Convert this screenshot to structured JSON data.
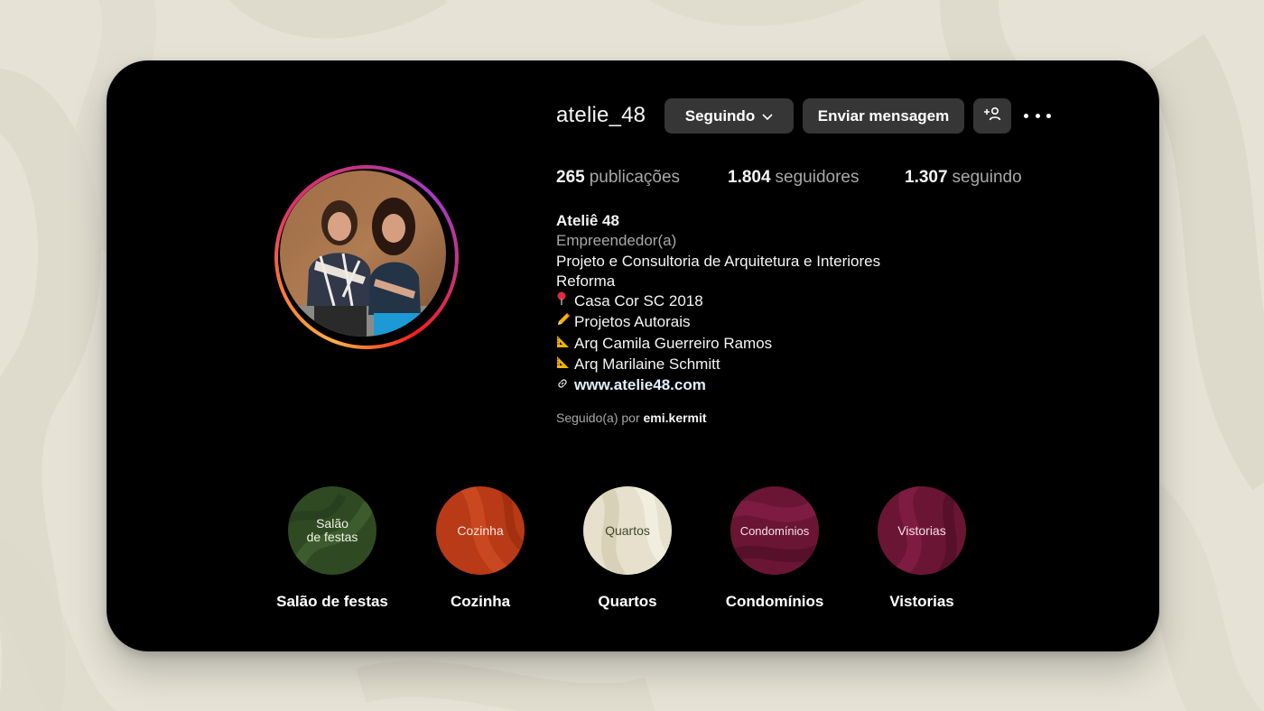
{
  "profile": {
    "username": "atelie_48",
    "following_button": "Seguindo",
    "message_button": "Enviar mensagem",
    "stats": {
      "posts_count": "265",
      "posts_label": "publicações",
      "followers_count": "1.804",
      "followers_label": "seguidores",
      "following_count": "1.307",
      "following_label": "seguindo"
    },
    "bio": {
      "name": "Ateliê 48",
      "category": "Empreendedor(a)",
      "line1": "Projeto e Consultoria de Arquitetura e Interiores",
      "line2": "Reforma",
      "line3": "Casa Cor SC 2018",
      "line4": "Projetos Autorais",
      "line5": "Arq Camila Guerreiro Ramos",
      "line6": "Arq Marilaine Schmitt",
      "link": "www.atelie48.com"
    },
    "followed_by_prefix": "Seguido(a) por",
    "followed_by_user": "emi.kermit"
  },
  "highlights": [
    {
      "cover_text": "Salão\nde festas",
      "label": "Salão de festas",
      "color": "#2f4a22"
    },
    {
      "cover_text": "Cozinha",
      "label": "Cozinha",
      "color": "#b83a17"
    },
    {
      "cover_text": "Quartos",
      "label": "Quartos",
      "color": "#e6e0cc"
    },
    {
      "cover_text": "Condomínios",
      "label": "Condomínios",
      "color": "#6a1534"
    },
    {
      "cover_text": "Vistorias",
      "label": "Vistorias",
      "color": "#6a1534"
    }
  ],
  "icons": [
    "chevron-down-icon",
    "add-user-icon",
    "more-options-icon",
    "pin-icon",
    "pencil-icon",
    "ruler-icon",
    "link-icon"
  ],
  "colors": {
    "background": "#e6e3d6",
    "card": "#000000",
    "button": "#363636",
    "secondary_text": "#a8a8a8",
    "link": "#e0f1ff"
  }
}
